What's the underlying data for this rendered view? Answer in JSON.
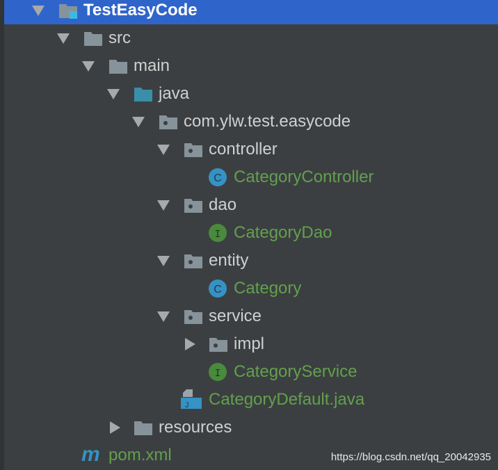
{
  "tree": [
    {
      "label": "TestEasyCode",
      "level": 0,
      "icon": "module-folder-icon",
      "arrow": "down",
      "selected": true
    },
    {
      "label": "src",
      "level": 1,
      "icon": "folder-icon",
      "arrow": "down"
    },
    {
      "label": "main",
      "level": 2,
      "icon": "folder-icon",
      "arrow": "down"
    },
    {
      "label": "java",
      "level": 3,
      "icon": "source-folder-icon",
      "arrow": "down"
    },
    {
      "label": "com.ylw.test.easycode",
      "level": 4,
      "icon": "package-icon",
      "arrow": "down"
    },
    {
      "label": "controller",
      "level": 5,
      "icon": "package-icon",
      "arrow": "down"
    },
    {
      "label": "CategoryController",
      "level": 6,
      "icon": "class-icon",
      "green": true
    },
    {
      "label": "dao",
      "level": 5,
      "icon": "package-icon",
      "arrow": "down"
    },
    {
      "label": "CategoryDao",
      "level": 6,
      "icon": "interface-icon",
      "green": true
    },
    {
      "label": "entity",
      "level": 5,
      "icon": "package-icon",
      "arrow": "down"
    },
    {
      "label": "Category",
      "level": 6,
      "icon": "class-icon",
      "green": true
    },
    {
      "label": "service",
      "level": 5,
      "icon": "package-icon",
      "arrow": "down"
    },
    {
      "label": "impl",
      "level": 6,
      "icon": "package-icon",
      "arrow": "right"
    },
    {
      "label": "CategoryService",
      "level": 6,
      "icon": "interface-icon",
      "green": true
    },
    {
      "label": "CategoryDefault.java",
      "level": 5,
      "icon": "java-file-icon",
      "green": true
    },
    {
      "label": "resources",
      "level": 3,
      "icon": "folder-icon",
      "arrow": "right"
    },
    {
      "label": "pom.xml",
      "level": 1,
      "icon": "maven-icon",
      "green": true
    }
  ],
  "icon_letters": {
    "class": "C",
    "interface": "I",
    "java": "J",
    "maven": "m"
  },
  "watermark": "https://blog.csdn.net/qq_20042935",
  "colors": {
    "selection": "#2f65ca",
    "green": "#62a04e",
    "class": "#3592c4",
    "interface": "#4a8a3c"
  }
}
